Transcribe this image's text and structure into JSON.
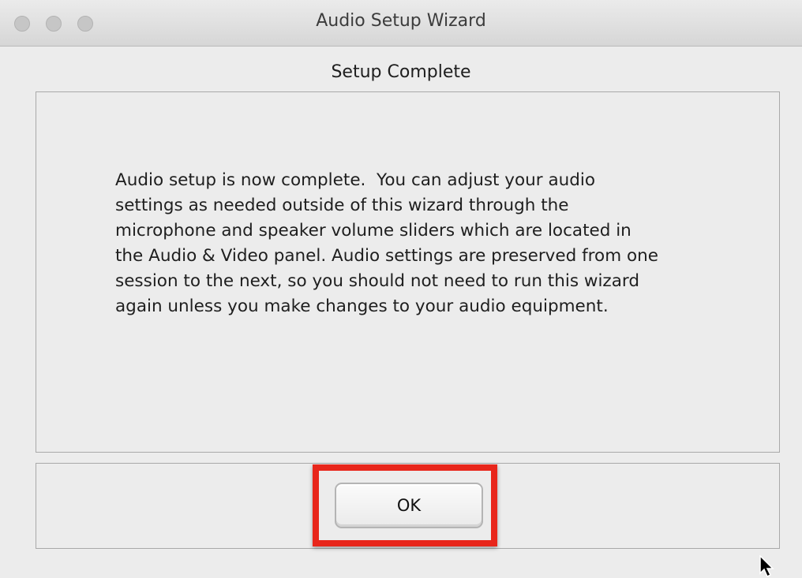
{
  "window": {
    "title": "Audio Setup Wizard"
  },
  "wizard": {
    "heading": "Setup Complete",
    "message": "Audio setup is now complete.  You can adjust your audio\nsettings as needed outside of this wizard through the\nmicrophone and speaker volume sliders which are located in\nthe Audio & Video panel. Audio settings are preserved from one\nsession to the next, so you should not need to run this wizard\nagain unless you make changes to your audio equipment.",
    "ok_label": "OK"
  },
  "icons": {
    "close": "close-icon",
    "minimize": "minimize-icon",
    "zoom": "zoom-icon",
    "pointer": "mouse-pointer-icon"
  },
  "colors": {
    "highlight": "#e8261b",
    "window_background": "#ececec"
  }
}
